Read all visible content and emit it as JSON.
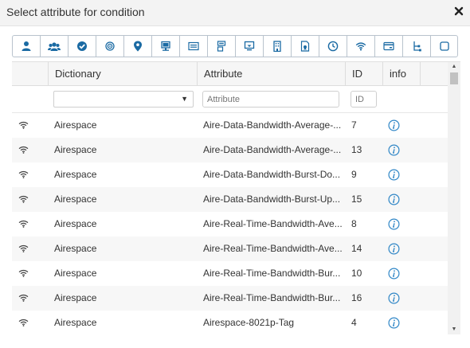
{
  "dialog": {
    "title": "Select attribute for condition",
    "close_icon": "close-icon"
  },
  "toolbar": {
    "accent_color": "#1a6aa3",
    "icons": [
      "user-icon",
      "group-icon",
      "check-circle-icon",
      "target-icon",
      "map-pin-icon",
      "desktop-icon",
      "screen-card-icon",
      "network-device-icon",
      "monitor-icon",
      "building-icon",
      "certificate-icon",
      "clock-icon",
      "wifi-icon",
      "card-reader-icon",
      "tree-icon",
      "blank-square-icon"
    ]
  },
  "table": {
    "columns": {
      "dictionary": "Dictionary",
      "attribute": "Attribute",
      "id": "ID",
      "info": "info"
    },
    "filters": {
      "dictionary_value": "",
      "attribute_placeholder": "Attribute",
      "id_placeholder": "ID"
    },
    "rows": [
      {
        "dictionary": "Airespace",
        "attribute": "Aire-Data-Bandwidth-Average-...",
        "id": "7"
      },
      {
        "dictionary": "Airespace",
        "attribute": "Aire-Data-Bandwidth-Average-...",
        "id": "13"
      },
      {
        "dictionary": "Airespace",
        "attribute": "Aire-Data-Bandwidth-Burst-Do...",
        "id": "9"
      },
      {
        "dictionary": "Airespace",
        "attribute": "Aire-Data-Bandwidth-Burst-Up...",
        "id": "15"
      },
      {
        "dictionary": "Airespace",
        "attribute": "Aire-Real-Time-Bandwidth-Ave...",
        "id": "8"
      },
      {
        "dictionary": "Airespace",
        "attribute": "Aire-Real-Time-Bandwidth-Ave...",
        "id": "14"
      },
      {
        "dictionary": "Airespace",
        "attribute": "Aire-Real-Time-Bandwidth-Bur...",
        "id": "10"
      },
      {
        "dictionary": "Airespace",
        "attribute": "Aire-Real-Time-Bandwidth-Bur...",
        "id": "16"
      },
      {
        "dictionary": "Airespace",
        "attribute": "Airespace-8021p-Tag",
        "id": "4"
      }
    ],
    "row_icon": "wifi-icon",
    "info_icon": "info-icon",
    "info_color": "#2f86c6"
  }
}
